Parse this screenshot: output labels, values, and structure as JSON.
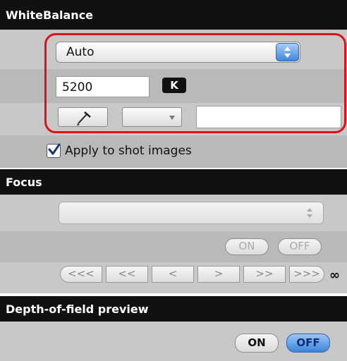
{
  "white_balance": {
    "title": "WhiteBalance",
    "mode_value": "Auto",
    "kelvin_value": "5200",
    "kelvin_unit": "K",
    "apply_label": "Apply to shot images",
    "apply_checked": true,
    "highlight_color": "#e0101a"
  },
  "focus": {
    "title": "Focus",
    "on_label": "ON",
    "off_label": "OFF",
    "nav": [
      "<<<",
      "<<",
      "<",
      ">",
      ">>",
      ">>>"
    ],
    "infinity": "∞"
  },
  "dof": {
    "title": "Depth-of-field preview",
    "on_label": "ON",
    "off_label": "OFF",
    "active": "OFF"
  },
  "icons": {
    "eyedropper": "eyedropper-icon",
    "checkmark": "checkmark-icon",
    "stepper": "stepper-arrows-icon",
    "dropdown": "dropdown-arrow-icon"
  },
  "colors": {
    "header_bg": "#111111",
    "selected_blue": "#3c84dc"
  }
}
